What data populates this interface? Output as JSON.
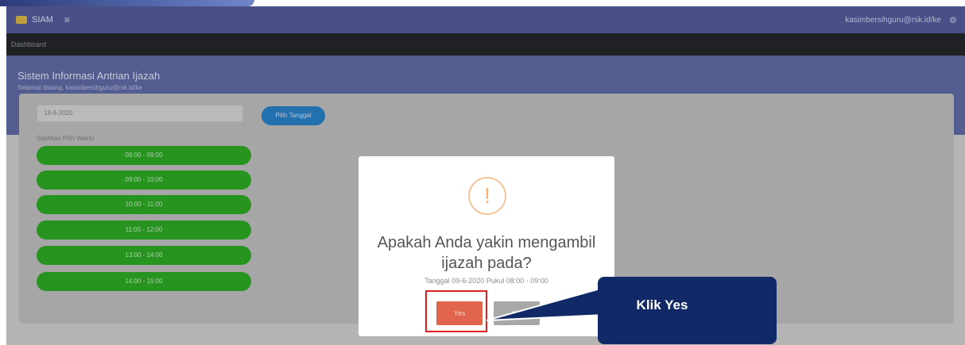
{
  "topbar": {
    "brand": "SIAM",
    "menu_icon": "menu-icon",
    "user_email": "kasimbersihguru@rsk.id/ke",
    "settings_icon": "gear-icon"
  },
  "navbar": {
    "item": "Dashboard"
  },
  "header": {
    "title": "Sistem Informasi Antrian Ijazah",
    "subtitle": "Selamat datang, kasimbersihguru@rsk.id/ke"
  },
  "form": {
    "date_value": "18-6-2020",
    "pick_button": "Pilih Tanggal",
    "slots_label": "Silahkan Pilih Waktu",
    "slots": [
      "08:00 - 09:00",
      "09:00 - 10:00",
      "10:00 - 11:00",
      "11:00 - 12:00",
      "13:00 - 14:00",
      "14:00 - 15:00"
    ]
  },
  "modal": {
    "icon": "warning-icon",
    "icon_glyph": "!",
    "title": "Apakah Anda yakin mengambil ijazah pada?",
    "detail": "Tanggal 09-6-2020 Pukul 08:00 - 09:00",
    "yes_label": "Yes",
    "no_label": "No"
  },
  "annotation": {
    "callout_text": "Klik Yes",
    "highlight_color": "#e02020",
    "callout_color": "#112a67"
  },
  "colors": {
    "topbar": "#4a5494",
    "header": "#59639e",
    "slot_green": "#24a41b",
    "pick_blue": "#1f79c4",
    "yes_button": "#e0654c"
  }
}
